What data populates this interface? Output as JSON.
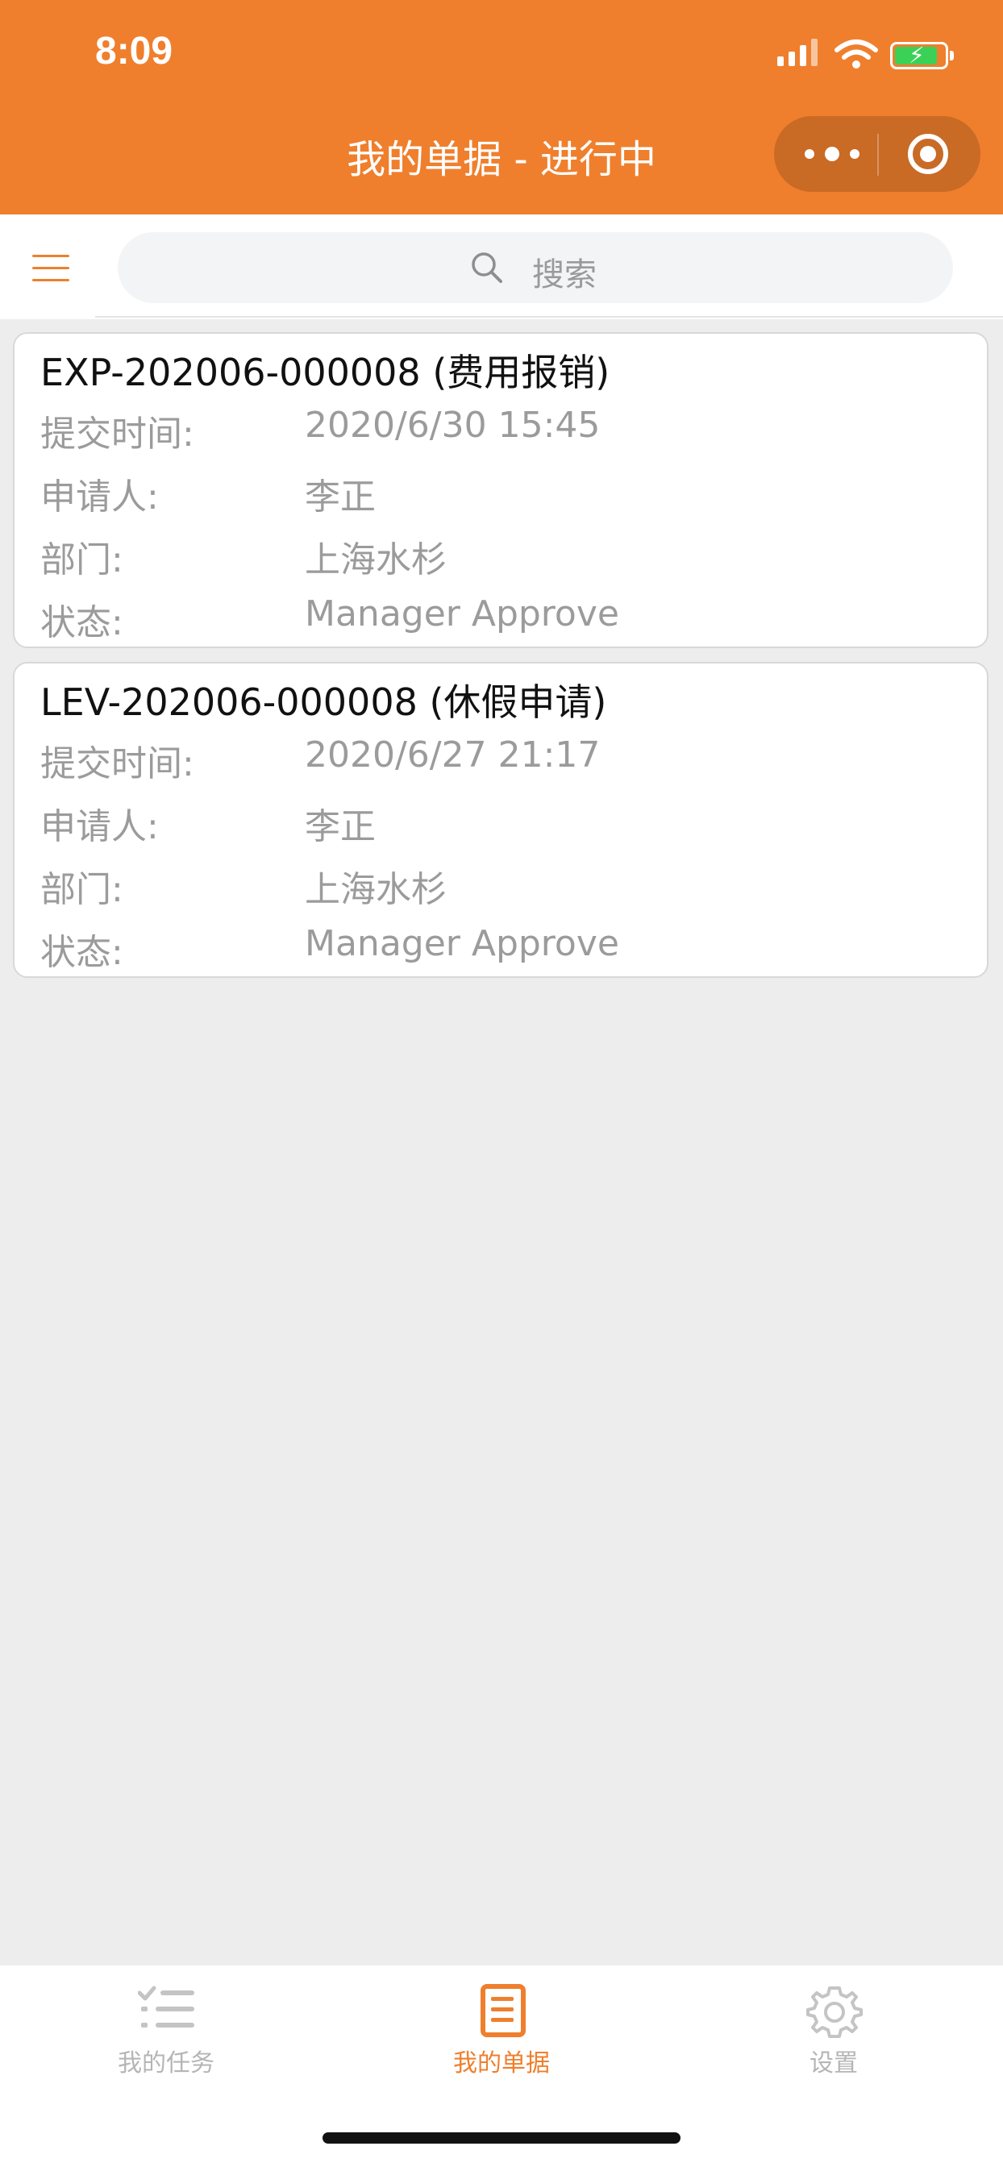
{
  "status_bar": {
    "time": "8:09"
  },
  "nav": {
    "title": "我的单据 - 进行中"
  },
  "search": {
    "placeholder": "搜索"
  },
  "documents": [
    {
      "title": "EXP-202006-000008 (费用报销)",
      "submit_time_label": "提交时间:",
      "submit_time": "2020/6/30 15:45",
      "applicant_label": "申请人:",
      "applicant": "李正",
      "department_label": "部门:",
      "department": "上海水杉",
      "status_label": "状态:",
      "status": "Manager Approve"
    },
    {
      "title": "LEV-202006-000008 (休假申请)",
      "submit_time_label": "提交时间:",
      "submit_time": "2020/6/27 21:17",
      "applicant_label": "申请人:",
      "applicant": "李正",
      "department_label": "部门:",
      "department": "上海水杉",
      "status_label": "状态:",
      "status": "Manager Approve"
    }
  ],
  "tabbar": {
    "items": [
      {
        "label": "我的任务",
        "icon": "task-list-icon",
        "active": false
      },
      {
        "label": "我的单据",
        "icon": "document-icon",
        "active": true
      },
      {
        "label": "设置",
        "icon": "gear-icon",
        "active": false
      }
    ]
  },
  "colors": {
    "brand": "#ef7f2d",
    "capsule": "#c96a25",
    "background": "#ededed",
    "inactive_tab": "#b5b5b5"
  }
}
